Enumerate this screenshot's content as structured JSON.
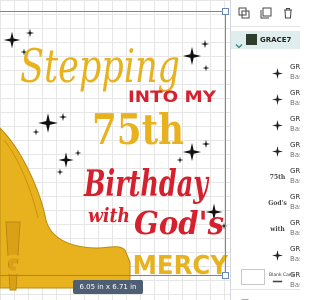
{
  "design": {
    "line1": "Stepping",
    "line2": "INTO MY",
    "line3": "75th",
    "line4": "Birthday",
    "line5": "with",
    "line6": "God's",
    "line7": "GRACE & MERCY"
  },
  "canvas": {
    "size_readout": "6.05  in x 6.71  in",
    "colors": {
      "gold": "#e8b21f",
      "red": "#d5212e",
      "black": "#111111",
      "selection": "#6b8ab3"
    }
  },
  "toolbar": {
    "icons": [
      "group-icon",
      "duplicate-icon",
      "delete-icon"
    ]
  },
  "layers": {
    "group_name": "GRACE7",
    "items": [
      {
        "name": "GRA",
        "type": "Bas",
        "thumb_icon": "sparkle-icon",
        "thumb_text": ""
      },
      {
        "name": "GRA",
        "type": "Bas",
        "thumb_icon": "sparkle-icon",
        "thumb_text": ""
      },
      {
        "name": "GRA",
        "type": "Bas",
        "thumb_icon": "stars-icon",
        "thumb_text": ""
      },
      {
        "name": "GRA",
        "type": "Bas",
        "thumb_icon": "sparkle-icon",
        "thumb_text": ""
      },
      {
        "name": "GRA",
        "type": "Bas",
        "thumb_icon": "text-icon",
        "thumb_text": "75th"
      },
      {
        "name": "GRA",
        "type": "Bas",
        "thumb_icon": "text-icon",
        "thumb_text": "God's"
      },
      {
        "name": "GRA",
        "type": "Bas",
        "thumb_icon": "text-icon",
        "thumb_text": "with"
      },
      {
        "name": "GRA",
        "type": "Bas",
        "thumb_icon": "sparkle-icon",
        "thumb_text": ""
      },
      {
        "name": "GRA",
        "type": "Bas",
        "thumb_icon": "text-icon",
        "thumb_text": ""
      }
    ],
    "blank_canvas_label": "Blank Canv"
  }
}
